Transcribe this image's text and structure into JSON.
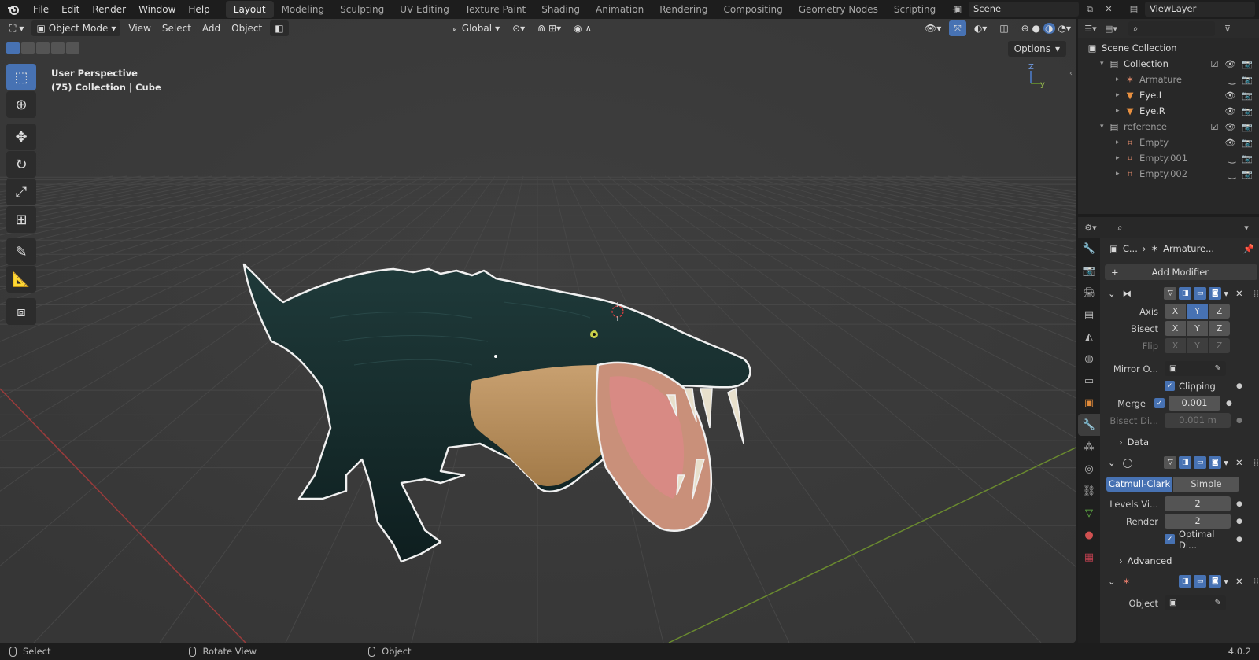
{
  "menu": [
    "File",
    "Edit",
    "Render",
    "Window",
    "Help"
  ],
  "workspaces": [
    "Layout",
    "Modeling",
    "Sculpting",
    "UV Editing",
    "Texture Paint",
    "Shading",
    "Animation",
    "Rendering",
    "Compositing",
    "Geometry Nodes",
    "Scripting"
  ],
  "active_workspace": "Layout",
  "scene_name": "Scene",
  "view_layer": "ViewLayer",
  "viewport": {
    "mode": "Object Mode",
    "menus": [
      "View",
      "Select",
      "Add",
      "Object"
    ],
    "transform_orientation": "Global",
    "options_label": "Options",
    "info_line1": "User Perspective",
    "info_line2": "(75) Collection | Cube",
    "gizmo_z": "Z",
    "gizmo_y": "y"
  },
  "outliner": {
    "scene_collection": "Scene Collection",
    "rows": [
      {
        "label": "Collection",
        "level": 1,
        "icon": "collection-icon"
      },
      {
        "label": "Armature",
        "level": 2,
        "icon": "armature-icon",
        "dim": true
      },
      {
        "label": "Eye.L",
        "level": 2,
        "icon": "mesh-icon"
      },
      {
        "label": "Eye.R",
        "level": 2,
        "icon": "mesh-icon"
      },
      {
        "label": "reference",
        "level": 1,
        "icon": "collection-icon",
        "dim": true
      },
      {
        "label": "Empty",
        "level": 2,
        "icon": "empty-icon",
        "dim": true
      },
      {
        "label": "Empty.001",
        "level": 2,
        "icon": "empty-icon",
        "dim": true
      },
      {
        "label": "Empty.002",
        "level": 2,
        "icon": "empty-icon",
        "dim": true
      }
    ]
  },
  "properties": {
    "breadcrumb_left": "C...",
    "breadcrumb_right": "Armature...",
    "add_modifier": "Add Modifier",
    "mirror": {
      "axis_label": "Axis",
      "bisect_label": "Bisect",
      "flip_label": "Flip",
      "axes": [
        "X",
        "Y",
        "Z"
      ],
      "mirror_object_label": "Mirror O...",
      "clipping_label": "Clipping",
      "merge_label": "Merge",
      "merge_value": "0.001",
      "bisect_distance_label": "Bisect Di...",
      "bisect_distance_value": "0.001 m",
      "data_panel": "Data"
    },
    "subsurf": {
      "catmull": "Catmull-Clark",
      "simple": "Simple",
      "levels_label": "Levels Vi...",
      "levels_value": "2",
      "render_label": "Render",
      "render_value": "2",
      "optimal_label": "Optimal Di...",
      "advanced_panel": "Advanced"
    },
    "armature": {
      "object_label": "Object"
    }
  },
  "status": {
    "select": "Select",
    "rotate": "Rotate View",
    "object": "Object",
    "version": "4.0.2"
  },
  "colors": {
    "accent": "#4772b3",
    "viewport_bg": "#3a3a3a"
  }
}
